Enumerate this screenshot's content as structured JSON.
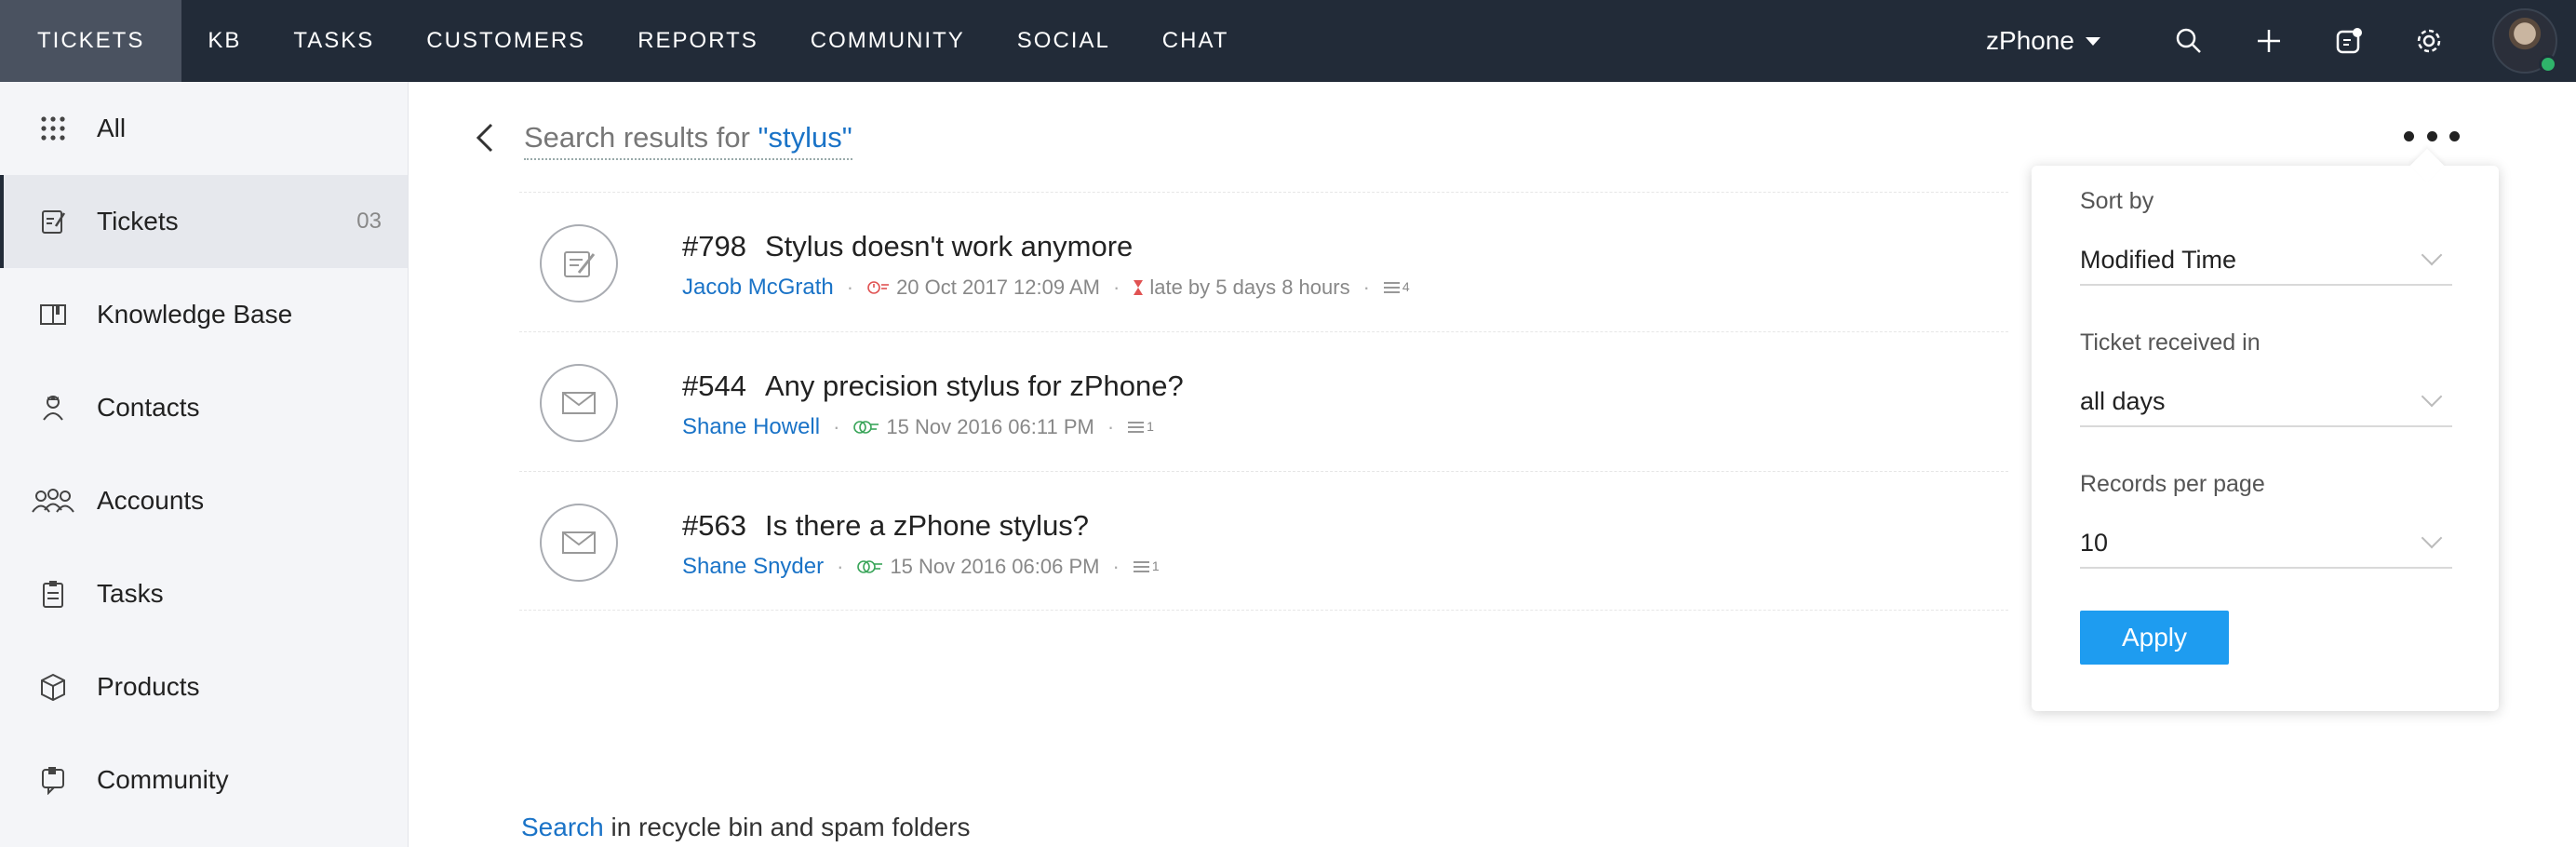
{
  "nav": {
    "tabs": [
      "TICKETS",
      "KB",
      "TASKS",
      "CUSTOMERS",
      "REPORTS",
      "COMMUNITY",
      "SOCIAL",
      "CHAT"
    ],
    "department": "zPhone"
  },
  "sidebar": {
    "items": [
      {
        "label": "All",
        "icon": "grid-icon"
      },
      {
        "label": "Tickets",
        "icon": "ticket-icon",
        "count": "03"
      },
      {
        "label": "Knowledge Base",
        "icon": "book-icon"
      },
      {
        "label": "Contacts",
        "icon": "contact-icon"
      },
      {
        "label": "Accounts",
        "icon": "accounts-icon"
      },
      {
        "label": "Tasks",
        "icon": "clipboard-icon"
      },
      {
        "label": "Products",
        "icon": "box-icon"
      },
      {
        "label": "Community",
        "icon": "community-icon"
      }
    ]
  },
  "search": {
    "prefix": "Search results for ",
    "term": "\"stylus\""
  },
  "tickets": [
    {
      "number": "#798",
      "subject": "Stylus doesn't work anymore",
      "contact": "Jacob McGrath",
      "date": "20 Oct 2017 12:09 AM",
      "status": "late by 5 days 8 hours",
      "threads": "4",
      "channel": "web"
    },
    {
      "number": "#544",
      "subject": "Any precision stylus for zPhone?",
      "contact": "Shane Howell",
      "date": "15 Nov 2016 06:11 PM",
      "threads": "1",
      "channel": "email"
    },
    {
      "number": "#563",
      "subject": "Is there a zPhone stylus?",
      "contact": "Shane Snyder",
      "date": "15 Nov 2016 06:06 PM",
      "threads": "1",
      "channel": "email"
    }
  ],
  "footer": {
    "link": "Search",
    "text": " in recycle bin and spam folders"
  },
  "panel": {
    "sort_label": "Sort by",
    "sort_value": "Modified Time",
    "received_label": "Ticket received in",
    "received_value": "all days",
    "records_label": "Records per page",
    "records_value": "10",
    "apply": "Apply"
  },
  "colors": {
    "nav_bg": "#222b38",
    "accent": "#1e9cf0",
    "link": "#1a73c7",
    "overdue": "#e05252",
    "ontime": "#3aa55a"
  }
}
